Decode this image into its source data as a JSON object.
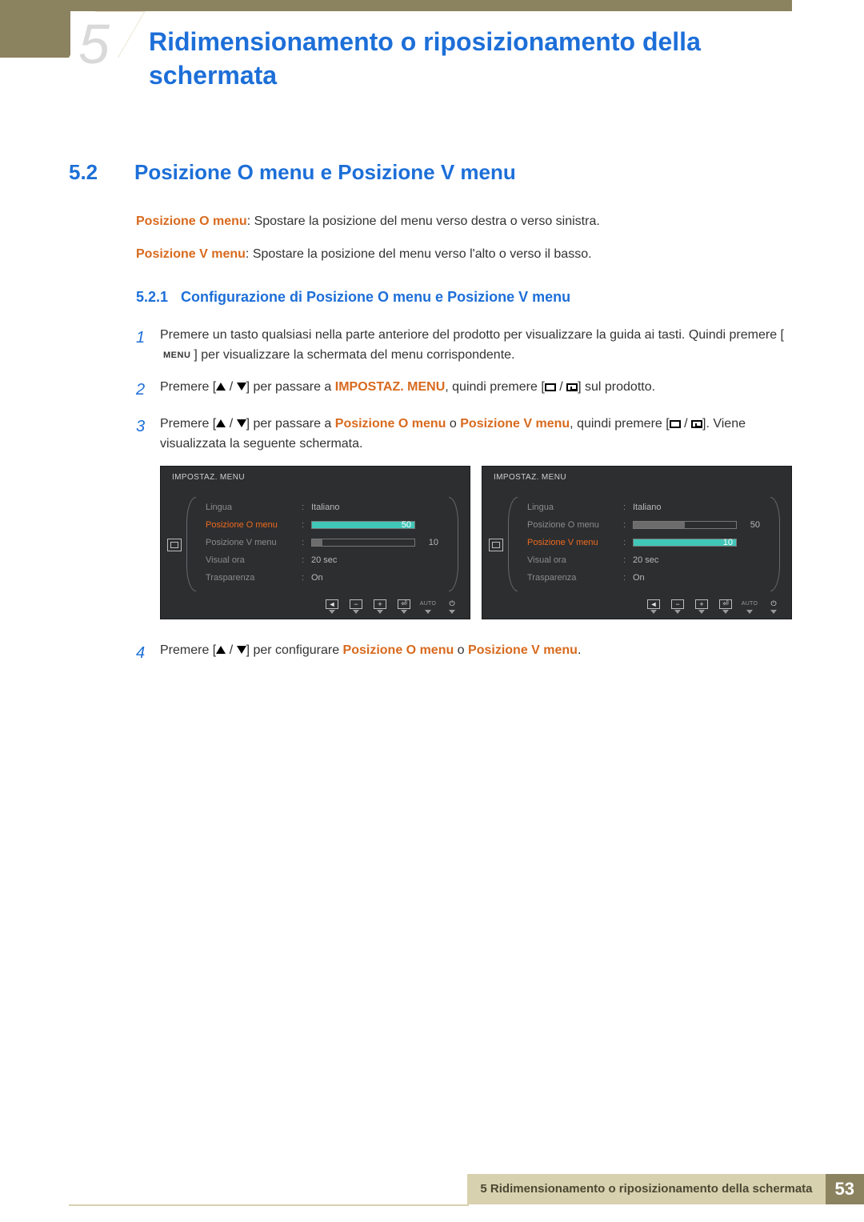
{
  "chapter_number": "5",
  "page_title": "Ridimensionamento o riposizionamento della schermata",
  "section": {
    "num": "5.2",
    "title": "Posizione O menu e Posizione V menu"
  },
  "intro": {
    "o_label": "Posizione O menu",
    "o_text": ": Spostare la posizione del menu verso destra o verso sinistra.",
    "v_label": "Posizione V menu",
    "v_text": ": Spostare la posizione del menu verso l'alto o verso il basso."
  },
  "subsection": {
    "num": "5.2.1",
    "title": "Configurazione di Posizione O menu e Posizione V menu"
  },
  "steps": {
    "s1a": "Premere un tasto qualsiasi nella parte anteriore del prodotto per visualizzare la guida ai tasti. Quindi premere [",
    "s1b": "] per visualizzare la schermata del menu corrispondente.",
    "menu_key": "MENU",
    "s2a": "Premere [",
    "s2b": "] per passare a ",
    "s2_impostaz": "IMPOSTAZ. MENU",
    "s2c": ", quindi premere [",
    "s2d": "] sul prodotto.",
    "s3a": "Premere [",
    "s3b": "] per passare a ",
    "s3_o": "Posizione O menu",
    "s3_or": " o ",
    "s3_v": "Posizione V menu",
    "s3c": ", quindi premere [",
    "s3d": "]. Viene visualizzata la seguente schermata.",
    "s4a": "Premere [",
    "s4b": "] per configurare ",
    "s4_o": "Posizione O menu",
    "s4_or": " o ",
    "s4_v": "Posizione V menu",
    "s4c": "."
  },
  "osd": {
    "title": "IMPOSTAZ. MENU",
    "rows": {
      "lingua": {
        "label": "Lingua",
        "value": "Italiano"
      },
      "pos_o": {
        "label": "Posizione O menu",
        "slider": 50
      },
      "pos_v": {
        "label": "Posizione V menu",
        "slider": 10
      },
      "visual": {
        "label": "Visual ora",
        "value": "20 sec"
      },
      "trasp": {
        "label": "Trasparenza",
        "value": "On"
      }
    },
    "footer_auto": "AUTO",
    "footer_back": "◄",
    "footer_minus": "−",
    "footer_plus": "+",
    "footer_enter": "⏎",
    "footer_pwr": "⏻"
  },
  "footer": {
    "text": "5 Ridimensionamento o riposizionamento della schermata",
    "page": "53"
  }
}
